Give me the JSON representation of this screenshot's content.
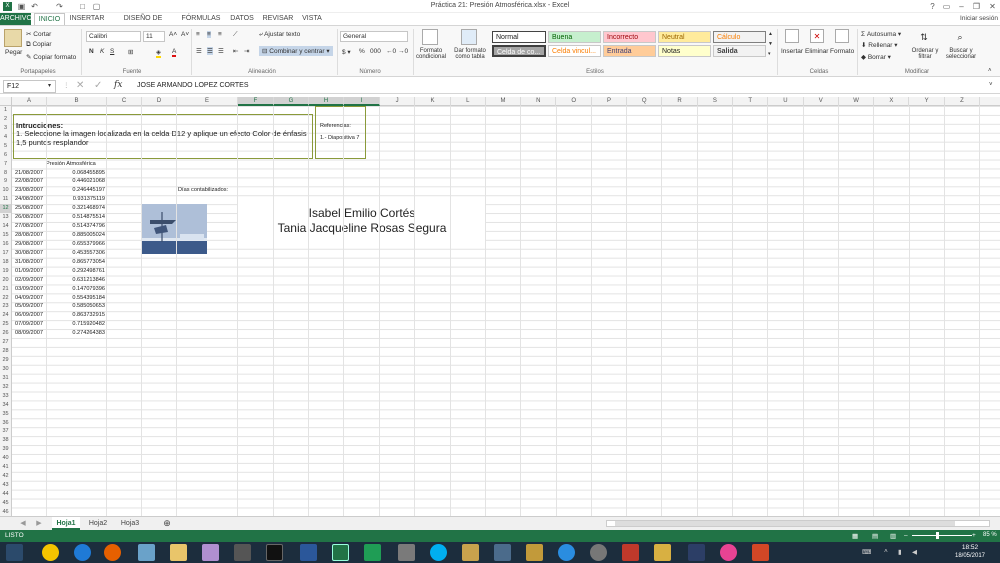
{
  "window": {
    "title": "Práctica 21: Presión Atmosférica.xlsx - Excel",
    "signin": "Iniciar sesión"
  },
  "tabs": [
    "ARCHIVO",
    "INICIO",
    "INSERTAR",
    "DISEÑO DE PÁGINA",
    "FÓRMULAS",
    "DATOS",
    "REVISAR",
    "VISTA"
  ],
  "ribbon": {
    "paste": "Pegar",
    "cut": "Cortar",
    "copy": "Copiar",
    "format_painter": "Copiar formato",
    "font_name": "Calibri",
    "font_size": "11",
    "bold": "N",
    "italic": "K",
    "underline": "S",
    "wrap": "Ajustar texto",
    "merge": "Combinar y centrar",
    "number_format": "General",
    "cond_format": "Formato condicional",
    "format_table": "Dar formato como tabla",
    "styles": [
      "Normal",
      "Buena",
      "Incorrecto",
      "Neutral",
      "Cálculo",
      "Celda de co...",
      "Celda vincul...",
      "Entrada",
      "Notas",
      "Salida"
    ],
    "insert": "Insertar",
    "delete": "Eliminar",
    "format": "Formato",
    "autosum": "Autosuma",
    "fill": "Rellenar",
    "clear": "Borrar",
    "sort": "Ordenar y filtrar",
    "find": "Buscar y seleccionar",
    "groups": [
      "Portapapeles",
      "Fuente",
      "Alineación",
      "Número",
      "Estilos",
      "Celdas",
      "Modificar"
    ]
  },
  "formula_bar": {
    "name_box": "F12",
    "fx": "fx",
    "content": "JOSE ARMANDO LOPEZ CORTES"
  },
  "columns": [
    "A",
    "B",
    "C",
    "D",
    "E",
    "F",
    "G",
    "H",
    "I",
    "J",
    "K",
    "L",
    "M",
    "N",
    "O",
    "P",
    "Q",
    "R",
    "S",
    "T",
    "U",
    "V",
    "W",
    "X",
    "Y",
    "Z"
  ],
  "rows": [
    "1",
    "2",
    "3",
    "4",
    "5",
    "6",
    "7",
    "8",
    "9",
    "10",
    "11",
    "12",
    "13",
    "14",
    "15",
    "16",
    "17",
    "18",
    "19",
    "20",
    "21",
    "22",
    "23",
    "24",
    "25",
    "26",
    "27",
    "28",
    "29",
    "30",
    "31",
    "32",
    "33",
    "34",
    "35",
    "36",
    "37",
    "38",
    "39",
    "40",
    "41",
    "42",
    "43",
    "44",
    "45",
    "46"
  ],
  "sheet": {
    "instructions_title": "Intrucciones:",
    "instructions_text": "1. Seleccione la imagen localizada en la celda D12 y aplique un efecto Color de énfasis 1,5 puntos resplandor",
    "ref_title": "Referencias:",
    "ref_item": "1.- Diapositiva 7",
    "header_b": "Presión Atmosférica",
    "dias_label": "Días contabilizados:",
    "names": [
      "Isabel Emilio Cortés",
      "Tania Jacqueline Rosas Segura"
    ],
    "data": [
      [
        "21/08/2007",
        "0.068455895"
      ],
      [
        "22/08/2007",
        "0.446021068"
      ],
      [
        "23/08/2007",
        "0.246445197"
      ],
      [
        "24/08/2007",
        "0.931375119"
      ],
      [
        "25/08/2007",
        "0.321468974"
      ],
      [
        "26/08/2007",
        "0.514875514"
      ],
      [
        "27/08/2007",
        "0.514374796"
      ],
      [
        "28/08/2007",
        "0.885005024"
      ],
      [
        "29/08/2007",
        "0.655379966"
      ],
      [
        "30/08/2007",
        "0.453557306"
      ],
      [
        "31/08/2007",
        "0.865773054"
      ],
      [
        "01/09/2007",
        "0.292498761"
      ],
      [
        "02/09/2007",
        "0.631213846"
      ],
      [
        "03/09/2007",
        "0.147079396"
      ],
      [
        "04/09/2007",
        "0.554395184"
      ],
      [
        "05/09/2007",
        "0.585050653"
      ],
      [
        "06/09/2007",
        "0.863732915"
      ],
      [
        "07/09/2007",
        "0.715920482"
      ],
      [
        "08/09/2007",
        "0.274264383"
      ]
    ]
  },
  "sheet_tabs": [
    "Hoja1",
    "Hoja2",
    "Hoja3"
  ],
  "status": {
    "ready": "LISTO",
    "zoom": "85 %"
  },
  "clock": {
    "time": "18:52",
    "date": "18/05/2017"
  },
  "colors": {
    "excel_green": "#217346",
    "taskbar": "#1c2d3d"
  }
}
